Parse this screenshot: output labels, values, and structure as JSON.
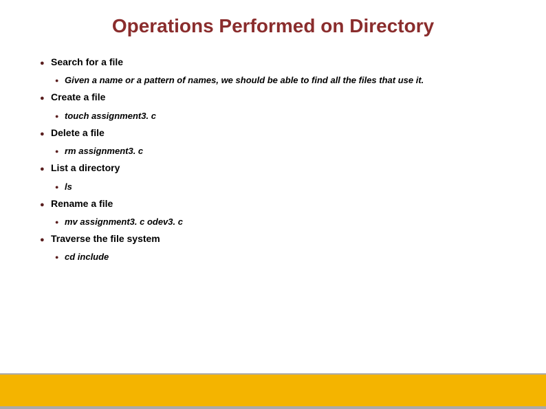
{
  "title": "Operations Performed on Directory",
  "items": [
    {
      "label": "Search for a file",
      "subitems": [
        "Given a name or a pattern of names, we should be able to find all the files that use it."
      ]
    },
    {
      "label": "Create a file",
      "subitems": [
        "touch assignment3. c"
      ]
    },
    {
      "label": "Delete a file",
      "subitems": [
        "rm assignment3. c"
      ]
    },
    {
      "label": "List a directory",
      "subitems": [
        "ls"
      ]
    },
    {
      "label": "Rename a file",
      "subitems": [
        "mv assignment3. c odev3. c"
      ]
    },
    {
      "label": "Traverse the file system",
      "subitems": [
        "cd include"
      ]
    }
  ]
}
